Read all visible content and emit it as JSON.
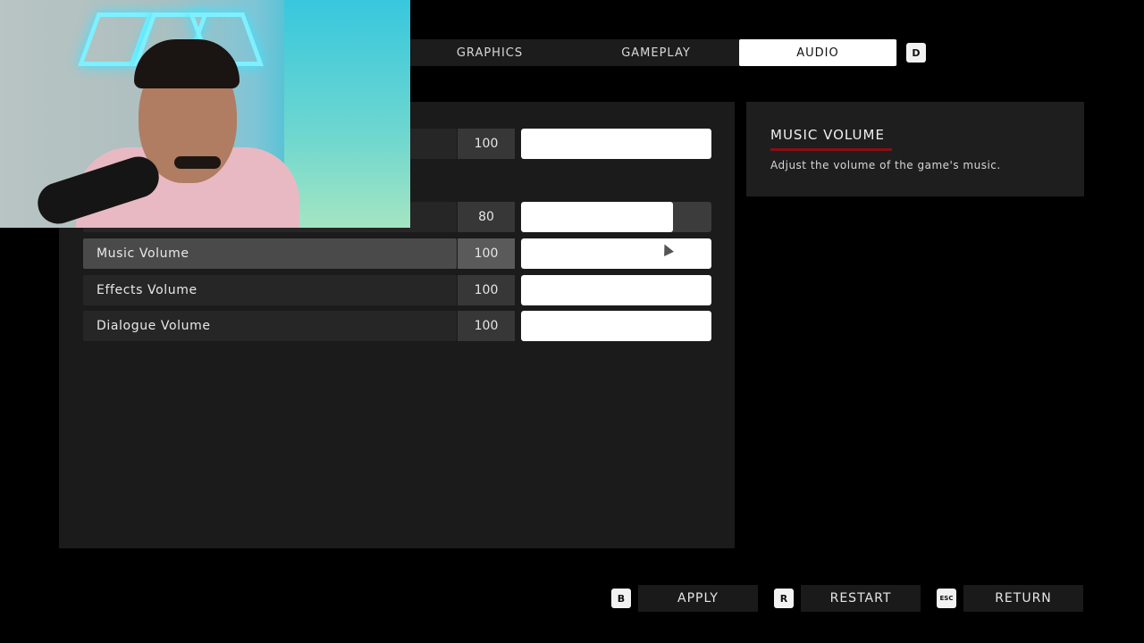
{
  "tabs": [
    {
      "label": "GRAPHICS",
      "active": false
    },
    {
      "label": "GAMEPLAY",
      "active": false
    },
    {
      "label": "AUDIO",
      "active": true
    }
  ],
  "tab_next_key": "D",
  "settings": [
    {
      "label": "",
      "value": "100",
      "level": 1.0,
      "selected": false
    },
    {
      "label": "",
      "value": "80",
      "level": 0.8,
      "selected": false
    },
    {
      "label": "Music Volume",
      "value": "100",
      "level": 1.0,
      "selected": true
    },
    {
      "label": "Effects Volume",
      "value": "100",
      "level": 1.0,
      "selected": false
    },
    {
      "label": "Dialogue Volume",
      "value": "100",
      "level": 1.0,
      "selected": false
    }
  ],
  "description": {
    "title": "MUSIC VOLUME",
    "text": "Adjust the volume of the game's music.",
    "accent_color": "#8a0f14"
  },
  "buttons": [
    {
      "key": "B",
      "label": "APPLY"
    },
    {
      "key": "R",
      "label": "RESTART"
    },
    {
      "key": "ESC",
      "label": "RETURN"
    }
  ]
}
